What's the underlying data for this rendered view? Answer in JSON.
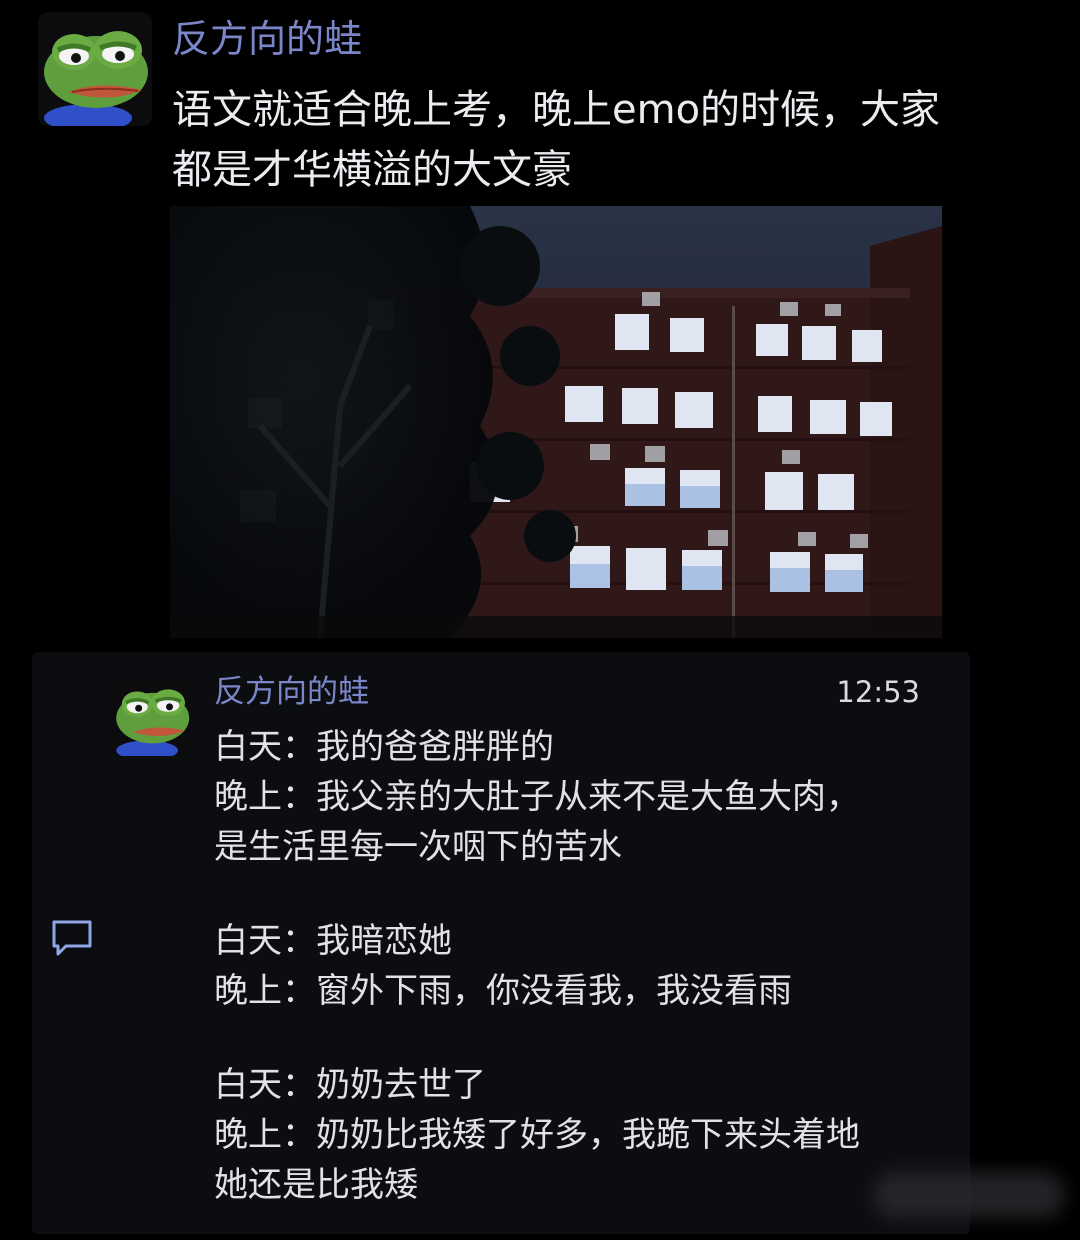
{
  "post": {
    "username": "反方向的蛙",
    "text": "语文就适合晚上考，晚上emo的时候，大家都是才华横溢的大文豪",
    "avatar_icon": "pepe-frog-avatar"
  },
  "comment": {
    "username": "反方向的蛙",
    "time": "12:53",
    "avatar_icon": "pepe-frog-avatar",
    "reply_icon": "comment-bubble-icon",
    "lines": [
      "白天：我的爸爸胖胖的",
      "晚上：我父亲的大肚子从来不是大鱼大肉，",
      "是生活里每一次咽下的苦水",
      "白天：我暗恋她",
      "晚上：窗外下雨，你没看我，我没看雨",
      "白天：奶奶去世了",
      "晚上：奶奶比我矮了好多，我跪下来头着地",
      "她还是比我矮"
    ]
  },
  "colors": {
    "background": "#000000",
    "username": "#7b86c8",
    "text": "#ecebf0",
    "card": "#0c0d10"
  }
}
